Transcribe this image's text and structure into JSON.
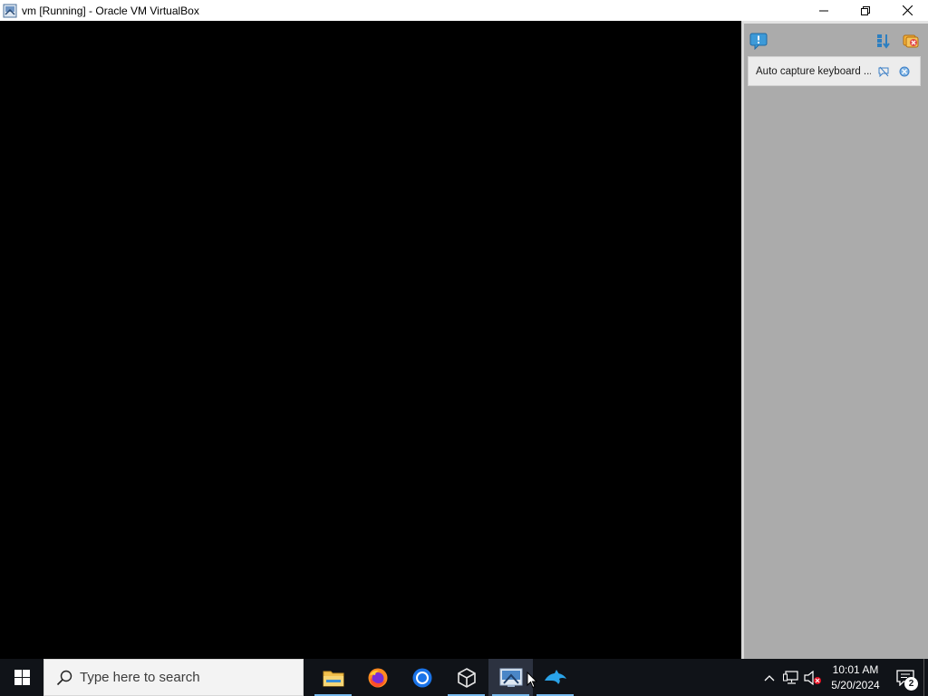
{
  "window": {
    "title": "vm [Running] - Oracle VM VirtualBox",
    "icon": "virtualbox-vm-icon"
  },
  "title_controls": [
    "minimize-icon",
    "restore-icon",
    "close-icon"
  ],
  "notification_center": {
    "toolbar": {
      "left_icon": "notification-center-icon",
      "right_icons": [
        "sort-icon",
        "close-all-icon"
      ]
    },
    "items": [
      {
        "text": "Auto capture keyboard ..."
      }
    ]
  },
  "taskbar": {
    "search_placeholder": "Type here to search",
    "apps": [
      {
        "name": "file-explorer",
        "running": true
      },
      {
        "name": "firefox",
        "running": false
      },
      {
        "name": "chrome",
        "running": false
      },
      {
        "name": "virtualbox-manager",
        "running": true
      },
      {
        "name": "virtualbox-vm",
        "running": true,
        "active": true
      },
      {
        "name": "dolphin",
        "running": true
      }
    ],
    "tray": {
      "time": "10:01 AM",
      "date": "5/20/2024",
      "notification_count": "2"
    }
  }
}
